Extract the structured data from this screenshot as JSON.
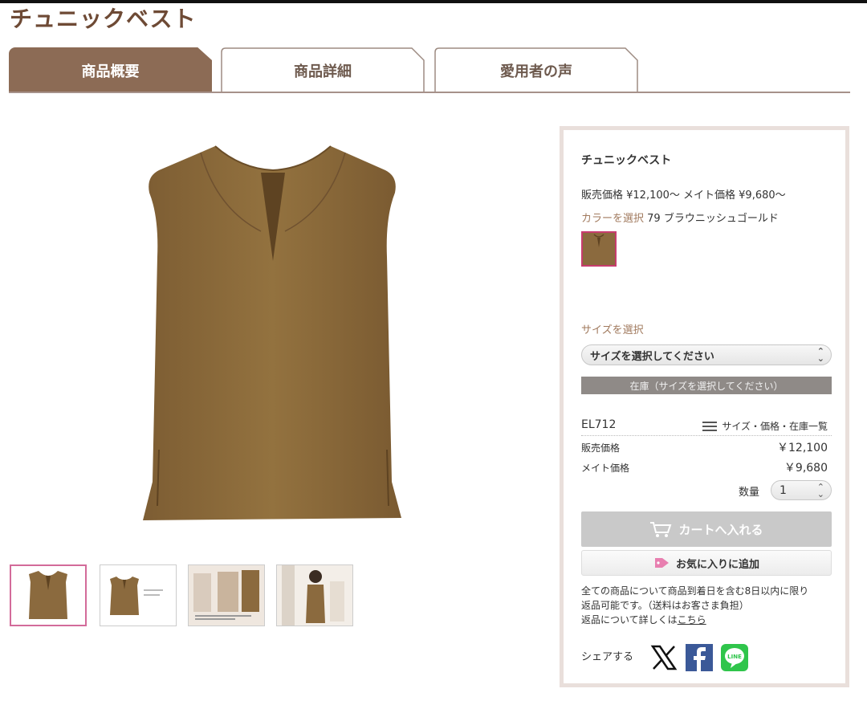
{
  "page": {
    "title": "チュニックベスト"
  },
  "tabs": [
    {
      "label": "商品概要",
      "active": true
    },
    {
      "label": "商品詳細",
      "active": false
    },
    {
      "label": "愛用者の声",
      "active": false
    }
  ],
  "product": {
    "name": "チュニックベスト",
    "price_summary": "販売価格 ¥12,100〜 メイト価格 ¥9,680〜",
    "color_label": "カラーを選択",
    "color_value": "79 ブラウニッシュゴールド",
    "size_label": "サイズを選択",
    "size_placeholder": "サイズを選択してください",
    "stock_text": "在庫（サイズを選択してください）",
    "sku": "EL712",
    "list_link": "サイズ・価格・在庫一覧",
    "sale_price_label": "販売価格",
    "sale_price": "￥12,100",
    "mate_price_label": "メイト価格",
    "mate_price": "￥9,680",
    "qty_label": "数量",
    "qty_value": "1",
    "cart_button": "カートへ入れる",
    "fav_button": "お気に入りに追加",
    "notice_line1": "全ての商品について商品到着日を含む8日以内に限り",
    "notice_line2": "返品可能です。（送料はお客さま負担）",
    "notice_line3_prefix": "返品について詳しくは",
    "notice_link": "こちら",
    "share_label": "シェアする"
  },
  "colors": {
    "brand_brown": "#8c6b55",
    "garment": "#8b6a3e",
    "highlight_pink": "#d36b9a"
  },
  "icons": [
    "list-icon",
    "cart-icon",
    "tag-heart-icon",
    "x-logo-icon",
    "facebook-icon",
    "line-icon"
  ]
}
